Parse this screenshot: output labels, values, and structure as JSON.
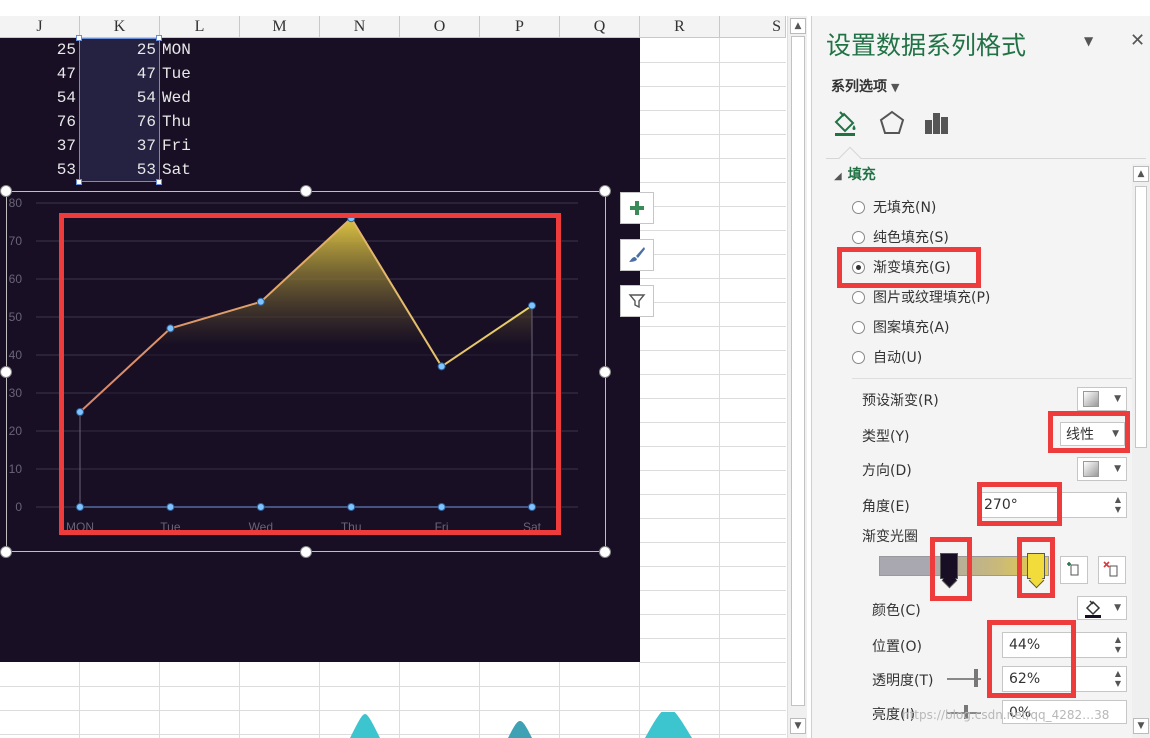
{
  "spreadsheet": {
    "column_headers": [
      "J",
      "K",
      "L",
      "M",
      "N",
      "O",
      "P",
      "Q",
      "R",
      "S"
    ],
    "rows": [
      {
        "j": "25",
        "k": "25",
        "l": "MON"
      },
      {
        "j": "47",
        "k": "47",
        "l": "Tue"
      },
      {
        "j": "54",
        "k": "54",
        "l": "Wed"
      },
      {
        "j": "76",
        "k": "76",
        "l": "Thu"
      },
      {
        "j": "37",
        "k": "37",
        "l": "Fri"
      },
      {
        "j": "53",
        "k": "53",
        "l": "Sat"
      }
    ]
  },
  "chart_data": {
    "type": "area",
    "categories": [
      "MON",
      "Tue",
      "Wed",
      "Thu",
      "Fri",
      "Sat"
    ],
    "series": [
      {
        "values": [
          25,
          47,
          54,
          76,
          37,
          53
        ]
      },
      {
        "values": [
          0,
          0,
          0,
          0,
          0,
          0
        ]
      }
    ],
    "yticks": [
      "80",
      "70",
      "60",
      "50",
      "40",
      "30",
      "20",
      "10",
      "0"
    ],
    "ylim": [
      0,
      80
    ],
    "grid": true,
    "colors": {
      "background": "#180f24",
      "gradient_top": "#e9cf44",
      "gradient_bottom": "#180f24",
      "line": "#d8b86a",
      "marker": "#7ec4ff",
      "gridline": "#3c3448",
      "axis_text": "#6a6478"
    }
  },
  "chart_buttons": {
    "add": "chart-elements-icon",
    "style": "chart-styles-icon",
    "filter": "chart-filters-icon"
  },
  "task_pane": {
    "title": "设置数据系列格式",
    "series_options_label": "系列选项",
    "fill_section": "填充",
    "fill_options": [
      {
        "label": "无填充(N)",
        "selected": false
      },
      {
        "label": "纯色填充(S)",
        "selected": false
      },
      {
        "label": "渐变填充(G)",
        "selected": true
      },
      {
        "label": "图片或纹理填充(P)",
        "selected": false
      },
      {
        "label": "图案填充(A)",
        "selected": false
      },
      {
        "label": "自动(U)",
        "selected": false
      }
    ],
    "preset_gradient_label": "预设渐变(R)",
    "type_label": "类型(Y)",
    "type_value": "线性",
    "direction_label": "方向(D)",
    "angle_label": "角度(E)",
    "angle_value": "270°",
    "gradient_stops_label": "渐变光圈",
    "color_label": "颜色(C)",
    "position_label": "位置(O)",
    "position_value": "44%",
    "transparency_label": "透明度(T)",
    "transparency_value": "62%",
    "brightness_label": "亮度(I)",
    "brightness_value": "0%",
    "stop_colors": [
      "#180f24",
      "#f2dc3c"
    ],
    "accent_color": "#217346",
    "highlight_color": "#ee3b3b"
  },
  "watermark": "https://blog.csdn.net/qq_4282…38"
}
